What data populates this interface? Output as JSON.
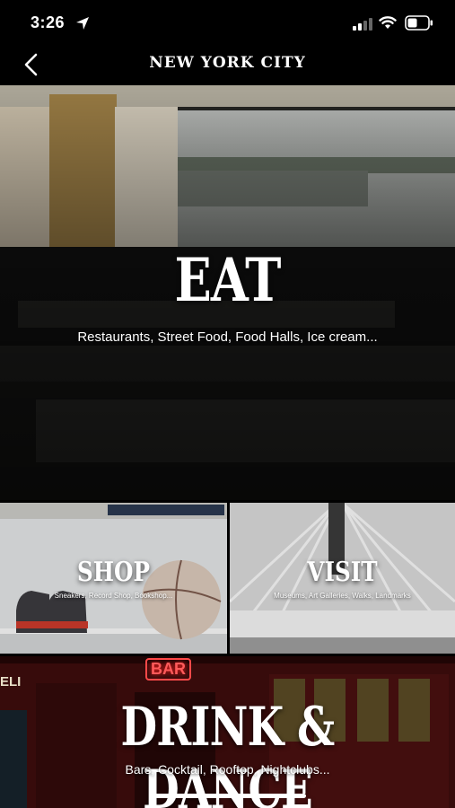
{
  "status_bar": {
    "time": "3:26",
    "icons": [
      "location-arrow-icon",
      "cellular-signal-icon",
      "wifi-icon",
      "battery-icon"
    ]
  },
  "nav": {
    "title": "NEW YORK CITY",
    "back_icon": "chevron-left-icon"
  },
  "tiles": {
    "eat": {
      "title": "EAT",
      "subtitle": "Restaurants,  Street Food, Food Halls, Ice cream..."
    },
    "shop": {
      "title": "SHOP",
      "subtitle": "Sneakers, Record Shop, Bookshop..."
    },
    "visit": {
      "title": "VISIT",
      "subtitle": "Museums, Art Galleries, Walks, Landmarks"
    },
    "drink": {
      "title": "DRINK & DANCE",
      "subtitle": "Bars, Cocktail, Rooftop, Nightclubs...",
      "neon_sign": "BAR",
      "storefront_sign": "ELI"
    }
  },
  "colors": {
    "background": "#000000",
    "text": "#ffffff",
    "bar_neon": "#ff3b3b"
  }
}
